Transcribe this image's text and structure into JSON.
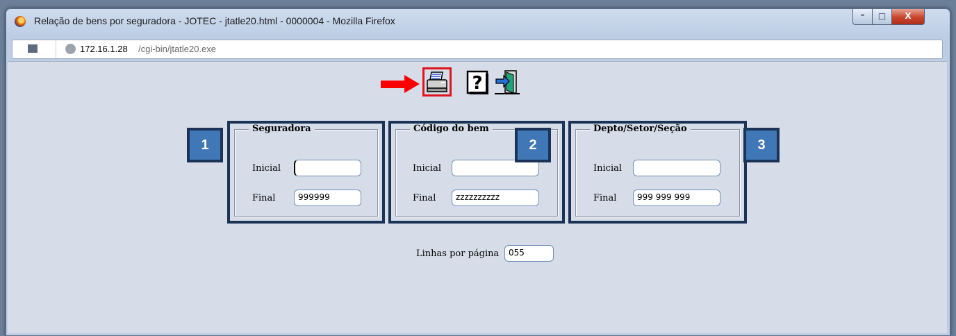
{
  "window": {
    "title": "Relação de bens por seguradora - JOTEC - jtatle20.html - 0000004 - Mozilla Firefox",
    "controls": {
      "minimize": "–",
      "maximize": "□",
      "close": "X"
    }
  },
  "address_bar": {
    "host": "172.16.1.28",
    "path": "/cgi-bin/jtatle20.exe"
  },
  "toolbar": {
    "icons": [
      "print-icon",
      "help-icon",
      "exit-icon"
    ],
    "highlight_color": "#e0141b",
    "arrow_color": "#ff0000"
  },
  "badges": [
    "1",
    "2",
    "3"
  ],
  "panels": {
    "seguradora": {
      "legend": "Seguradora",
      "inicial_label": "Inicial",
      "inicial_value": "",
      "final_label": "Final",
      "final_value": "999999"
    },
    "codigo_bem": {
      "legend": "Código do bem",
      "inicial_label": "Inicial",
      "inicial_value": "",
      "final_label": "Final",
      "final_value": "zzzzzzzzzz"
    },
    "depto": {
      "legend": "Depto/Setor/Seção",
      "inicial_label": "Inicial",
      "inicial_value": "",
      "final_label": "Final",
      "final_value": "999 999 999"
    }
  },
  "linhas": {
    "label": "Linhas por página",
    "value": "055"
  },
  "colors": {
    "badge_fill": "#3f77b7",
    "badge_border": "#1b3356",
    "content_bg": "#d6dde8"
  }
}
